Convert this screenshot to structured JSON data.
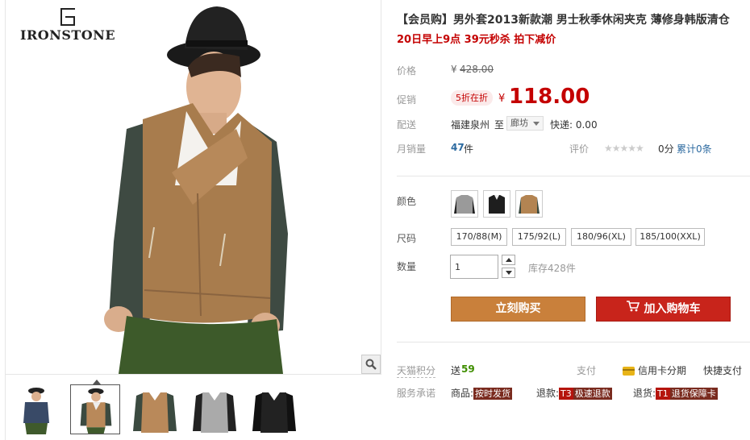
{
  "gallery": {
    "brand_name": "IRONSTONE",
    "main_image_alt": "男士秋季休闲夹克",
    "thumbnails": [
      {
        "name": "thumb-1",
        "colors": [
          "#394a67",
          "#2a2a2a",
          "#3f5a2c"
        ]
      },
      {
        "name": "thumb-2",
        "colors": [
          "#b9895a",
          "#3b4a40",
          "#eeeeee"
        ]
      },
      {
        "name": "thumb-3",
        "colors": [
          "#b9895a",
          "#3b4a40",
          "#b9895a"
        ]
      },
      {
        "name": "thumb-4",
        "colors": [
          "#aaaaaa",
          "#222222",
          "#aaaaaa"
        ]
      },
      {
        "name": "thumb-5",
        "colors": [
          "#222222",
          "#111111",
          "#222222"
        ]
      }
    ]
  },
  "product": {
    "title": "【会员购】男外套2013新款潮 男士秋季休闲夹克 薄修身韩版清仓",
    "subtitle": "20日早上9点 39元秒杀 拍下减价"
  },
  "pricing": {
    "original_label": "价格",
    "original_currency": "¥",
    "original_price": "428.00",
    "promo_label": "促销",
    "promo_tag": "5折在折",
    "promo_currency": "¥",
    "promo_price": "118.00"
  },
  "shipping": {
    "label": "配送",
    "origin": "福建泉州",
    "to": "至",
    "destination": "廊坊",
    "express": "快递: 0.00"
  },
  "sales": {
    "label": "月销量",
    "count": "47",
    "unit": "件",
    "review_label": "评价",
    "stars": "★★★★★",
    "score": "0分",
    "review_total": "累计0条"
  },
  "options": {
    "color_label": "颜色",
    "colors": [
      {
        "name": "gray",
        "hex": "#9a9a9a"
      },
      {
        "name": "black",
        "hex": "#1e1e1e"
      },
      {
        "name": "khaki",
        "hex": "#b38452"
      }
    ],
    "size_label": "尺码",
    "sizes": [
      "170/88(M)",
      "175/92(L)",
      "180/96(XL)",
      "185/100(XXL)"
    ],
    "qty_label": "数量",
    "qty_value": "1",
    "stock": "库存428件"
  },
  "actions": {
    "buy_now": "立刻购买",
    "add_to_cart": "加入购物车"
  },
  "services": {
    "points_label": "天猫积分",
    "points_prefix": "送",
    "points_value": "59",
    "pay_label": "支付",
    "credit_installment": "信用卡分期",
    "quick_pay": "快捷支付",
    "promise_label": "服务承诺",
    "goods_label": "商品:",
    "goods_badge": "按时发货",
    "refund_label": "退款:",
    "refund_code": "T3",
    "refund_badge": "极速退款",
    "return_label": "退货:",
    "return_code": "T1",
    "return_badge": "退货保障卡"
  },
  "theme": {
    "price_red": "#c40000",
    "buy_orange": "#c9803b",
    "cart_red": "#c8241b",
    "points_green": "#3f8e00"
  }
}
